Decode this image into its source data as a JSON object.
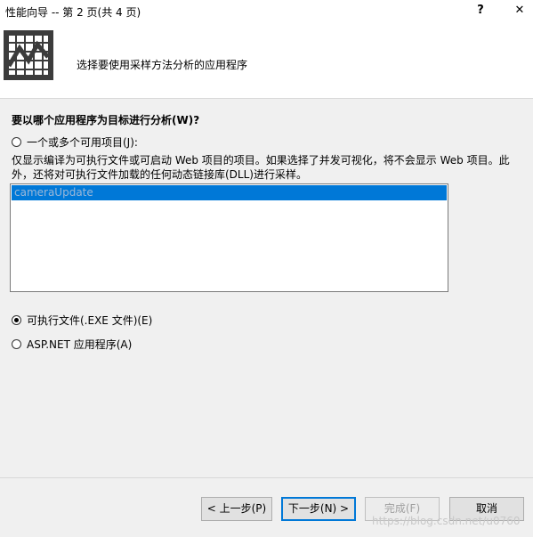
{
  "window": {
    "title": "性能向导 -- 第 2 页(共 4 页)",
    "help": "?",
    "close": "✕"
  },
  "header": {
    "instruction": "选择要使用采样方法分析的应用程序"
  },
  "main": {
    "question": "要以哪个应用程序为目标进行分析(W)?",
    "options": [
      {
        "label": "一个或多个可用项目(J):",
        "checked": false
      },
      {
        "label": "可执行文件(.EXE 文件)(E)",
        "checked": true
      },
      {
        "label": "ASP.NET 应用程序(A)",
        "checked": false
      }
    ],
    "description": "仅显示编译为可执行文件或可启动 Web 项目的项目。如果选择了并发可视化，将不会显示 Web 项目。此外，还将对可执行文件加载的任何动态链接库(DLL)进行采样。",
    "projects": [
      "cameraUpdate"
    ]
  },
  "buttons": {
    "prev": "< 上一步(P)",
    "next": "下一步(N) >",
    "finish": "完成(F)",
    "cancel": "取消"
  },
  "watermark": "https://blog.csdn.net/u0760"
}
